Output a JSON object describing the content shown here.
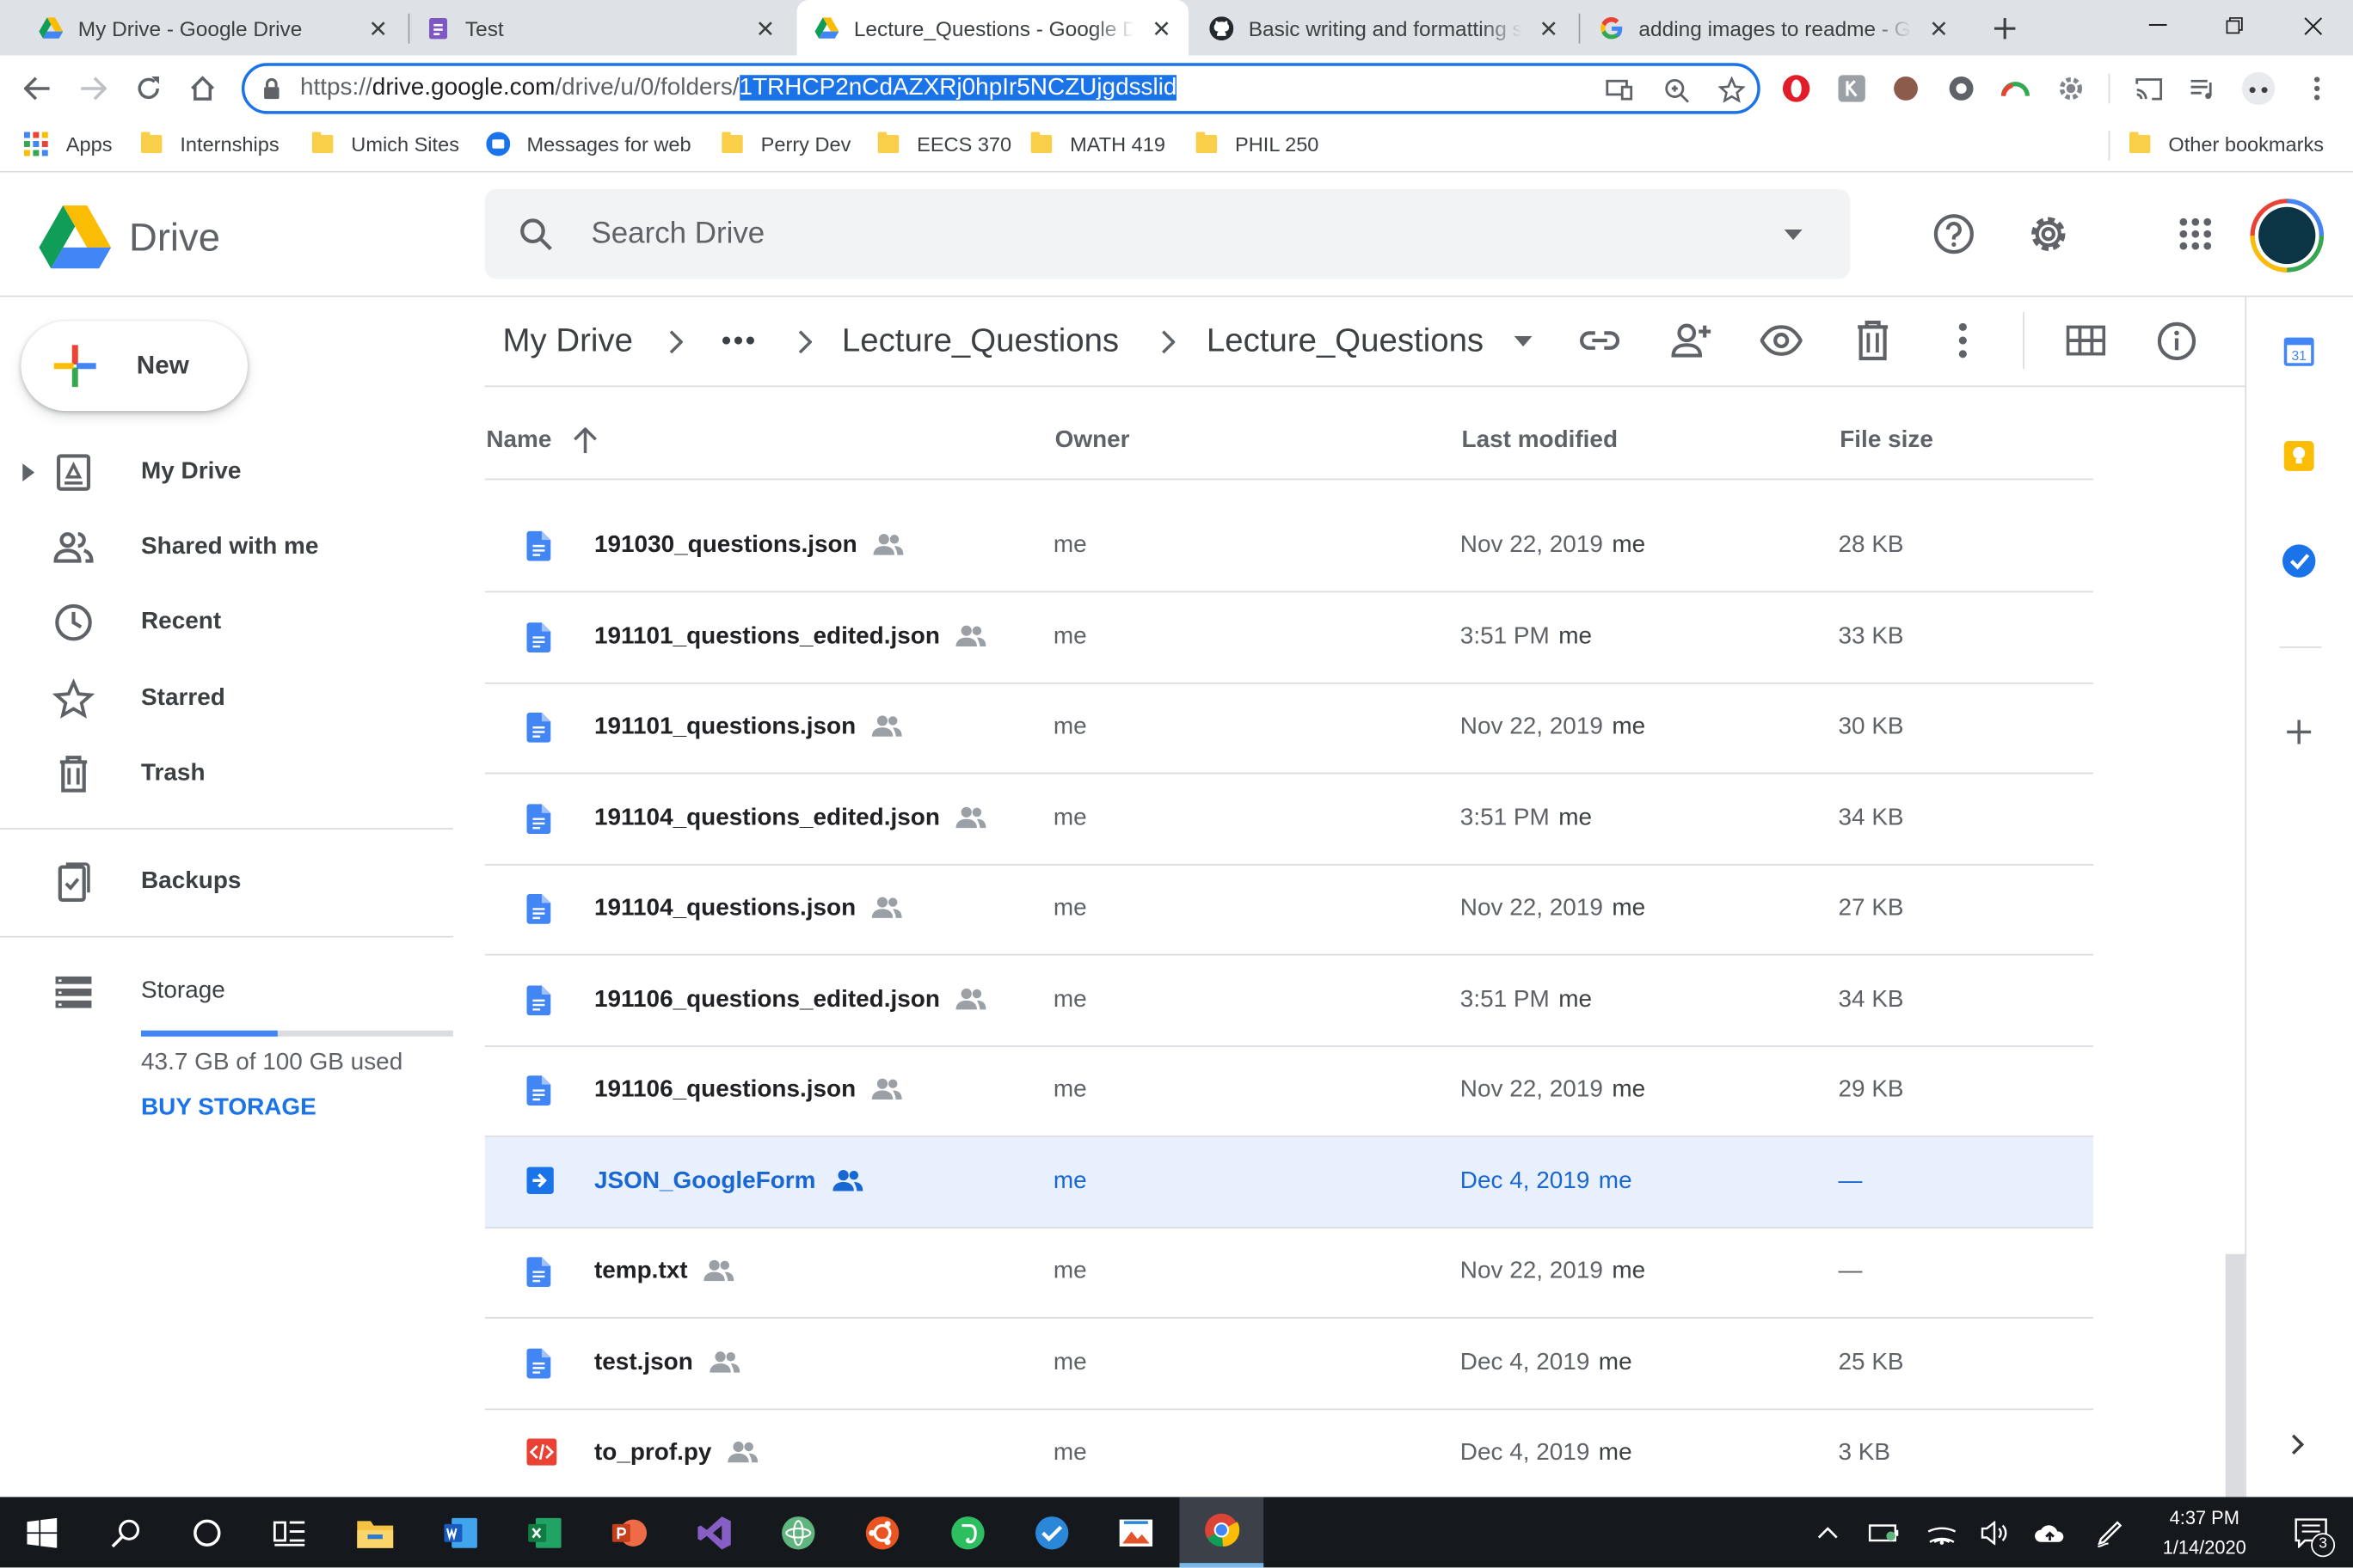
{
  "browser": {
    "tabs": [
      {
        "title": "My Drive - Google Drive",
        "favicon": "google-drive-icon"
      },
      {
        "title": "Test",
        "favicon": "google-forms-icon"
      },
      {
        "title": "Lecture_Questions - Google Drive",
        "favicon": "google-drive-icon",
        "active": true
      },
      {
        "title": "Basic writing and formatting sy",
        "favicon": "github-icon"
      },
      {
        "title": "adding images to readme - Go",
        "favicon": "google-icon"
      }
    ],
    "url_prefix": "https://",
    "url_host": "drive.google.com",
    "url_path": "/drive/u/0/folders/",
    "url_selected": "1TRHCP2nCdAZXRj0hpIr5NCZUjgdsslid",
    "bookmarks": [
      "Apps",
      "Internships",
      "Umich Sites",
      "Messages for web",
      "Perry Dev",
      "EECS 370",
      "MATH 419",
      "PHIL 250"
    ],
    "other_bookmarks": "Other bookmarks"
  },
  "drive": {
    "logo_text": "Drive",
    "search_placeholder": "Search Drive",
    "new_label": "New",
    "nav": [
      "My Drive",
      "Shared with me",
      "Recent",
      "Starred",
      "Trash",
      "Backups",
      "Storage"
    ],
    "storage_used_text": "43.7 GB of 100 GB used",
    "storage_fraction": 0.437,
    "buy_storage": "BUY STORAGE",
    "breadcrumb": [
      "My Drive",
      "Lecture_Questions",
      "Lecture_Questions"
    ],
    "columns": {
      "name": "Name",
      "owner": "Owner",
      "last_modified": "Last modified",
      "file_size": "File size"
    },
    "files": [
      {
        "name": "191030_questions.json",
        "owner": "me",
        "modified": "Nov 22, 2019",
        "modifier": "me",
        "size": "28 KB",
        "type": "doc"
      },
      {
        "name": "191101_questions_edited.json",
        "owner": "me",
        "modified": "3:51 PM",
        "modifier": "me",
        "size": "33 KB",
        "type": "doc"
      },
      {
        "name": "191101_questions.json",
        "owner": "me",
        "modified": "Nov 22, 2019",
        "modifier": "me",
        "size": "30 KB",
        "type": "doc"
      },
      {
        "name": "191104_questions_edited.json",
        "owner": "me",
        "modified": "3:51 PM",
        "modifier": "me",
        "size": "34 KB",
        "type": "doc"
      },
      {
        "name": "191104_questions.json",
        "owner": "me",
        "modified": "Nov 22, 2019",
        "modifier": "me",
        "size": "27 KB",
        "type": "doc"
      },
      {
        "name": "191106_questions_edited.json",
        "owner": "me",
        "modified": "3:51 PM",
        "modifier": "me",
        "size": "34 KB",
        "type": "doc"
      },
      {
        "name": "191106_questions.json",
        "owner": "me",
        "modified": "Nov 22, 2019",
        "modifier": "me",
        "size": "29 KB",
        "type": "doc"
      },
      {
        "name": "JSON_GoogleForm",
        "owner": "me",
        "modified": "Dec 4, 2019",
        "modifier": "me",
        "size": "—",
        "type": "shortcut",
        "selected": true
      },
      {
        "name": "temp.txt",
        "owner": "me",
        "modified": "Nov 22, 2019",
        "modifier": "me",
        "size": "—",
        "type": "doc"
      },
      {
        "name": "test.json",
        "owner": "me",
        "modified": "Dec 4, 2019",
        "modifier": "me",
        "size": "25 KB",
        "type": "doc"
      },
      {
        "name": "to_prof.py",
        "owner": "me",
        "modified": "Dec 4, 2019",
        "modifier": "me",
        "size": "3 KB",
        "type": "code"
      }
    ]
  },
  "taskbar": {
    "time": "4:37 PM",
    "date": "1/14/2020",
    "notification_count": "3"
  },
  "colors": {
    "accent": "#1a73e8",
    "selected_row": "#e8f0fe",
    "doc_blue": "#4285f4",
    "code_red": "#e94235"
  }
}
